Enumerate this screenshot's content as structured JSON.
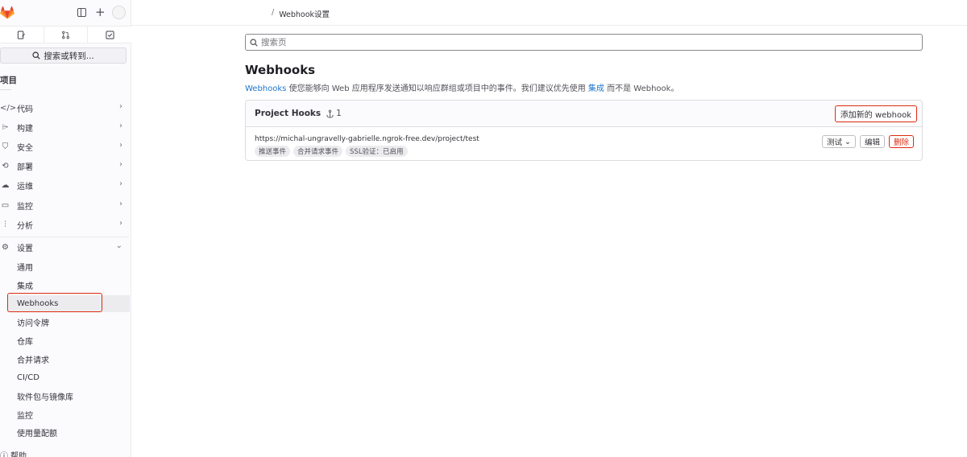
{
  "header": {
    "breadcrumb_sep": "/",
    "breadcrumb_current": "Webhook设置"
  },
  "sidebar": {
    "search_label": "搜索或转到...",
    "project_label": "项目",
    "nav": [
      {
        "label": "代码",
        "icon": "code-icon"
      },
      {
        "label": "构建",
        "icon": "rocket-icon"
      },
      {
        "label": "安全",
        "icon": "shield-icon"
      },
      {
        "label": "部署",
        "icon": "deploy-icon"
      },
      {
        "label": "运维",
        "icon": "cloud-icon"
      },
      {
        "label": "监控",
        "icon": "monitor-icon"
      },
      {
        "label": "分析",
        "icon": "chart-icon"
      }
    ],
    "settings_label": "设置",
    "sub_items": [
      "通用",
      "集成",
      "Webhooks",
      "访问令牌",
      "仓库",
      "合并请求",
      "CI/CD",
      "软件包与镜像库",
      "监控",
      "使用量配额"
    ],
    "help_label": "帮助"
  },
  "main": {
    "search_placeholder": "搜索页",
    "title": "Webhooks",
    "desc_link1": "Webhooks",
    "desc_text1": " 使您能够向 Web 应用程序发送通知以响应群组或项目中的事件。我们建议优先使用 ",
    "desc_link2": "集成",
    "desc_text2": " 而不是 Webhook。",
    "card": {
      "title": "Project Hooks",
      "count": "1",
      "add_button": "添加新的 webhook",
      "hook": {
        "url": "https://michal-ungravelly-gabrielle.ngrok-free.dev/project/test",
        "tags": [
          "推送事件",
          "合并请求事件",
          "SSL验证：已启用"
        ],
        "test_button": "测试",
        "edit_button": "编辑",
        "delete_button": "删除"
      }
    }
  },
  "colors": {
    "link": "#1f75cb",
    "danger": "#dd2b0e",
    "logo": "#fc6d26"
  }
}
